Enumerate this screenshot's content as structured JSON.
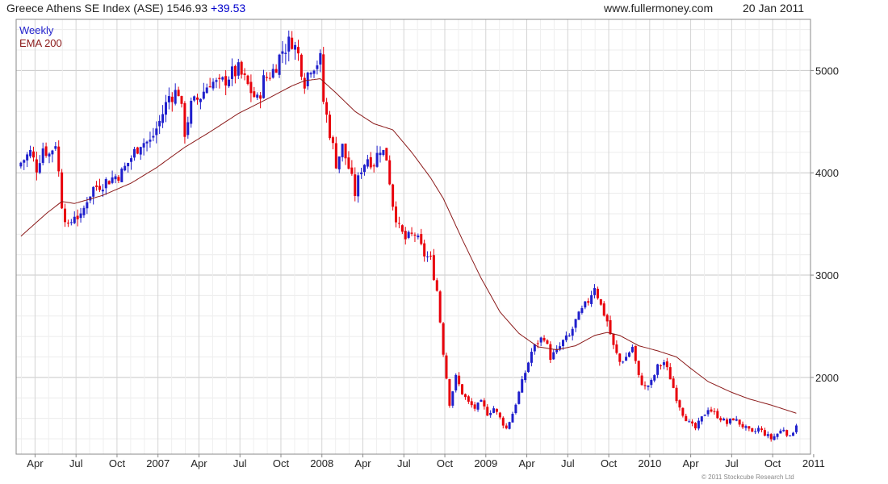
{
  "header": {
    "title": "Greece Athens SE Index (ASE) 1546.93",
    "change": "+39.53",
    "site": "www.fullermoney.com",
    "date": "20 Jan 2011"
  },
  "legend": {
    "period": "Weekly",
    "ema": "EMA 200"
  },
  "copyright": "© 2011 Stockcube Research Ltd",
  "colors": {
    "up": "#1f1fcc",
    "down": "#e8000b",
    "ema": "#8b1a1a",
    "grid": "#dddddd"
  },
  "chart_data": {
    "type": "candlestick",
    "title": "Greece Athens SE Index (ASE)",
    "xlabel": "",
    "ylabel": "",
    "ylim": [
      1250,
      5500
    ],
    "y_ticks": [
      2000,
      3000,
      4000,
      5000
    ],
    "x_ticks": [
      {
        "week": 4.5,
        "label": "Apr"
      },
      {
        "week": 17.5,
        "label": "Jul"
      },
      {
        "week": 30.5,
        "label": "Oct"
      },
      {
        "week": 43.5,
        "label": "2007"
      },
      {
        "week": 56.5,
        "label": "Apr"
      },
      {
        "week": 69.5,
        "label": "Jul"
      },
      {
        "week": 82.5,
        "label": "Oct"
      },
      {
        "week": 95.5,
        "label": "2008"
      },
      {
        "week": 108.5,
        "label": "Apr"
      },
      {
        "week": 121.5,
        "label": "Jul"
      },
      {
        "week": 134.5,
        "label": "Oct"
      },
      {
        "week": 147.5,
        "label": "2009"
      },
      {
        "week": 160.5,
        "label": "Apr"
      },
      {
        "week": 173.5,
        "label": "Jul"
      },
      {
        "week": 186.5,
        "label": "Oct"
      },
      {
        "week": 199.5,
        "label": "2010"
      },
      {
        "week": 212.5,
        "label": "Apr"
      },
      {
        "week": 225.5,
        "label": "Jul"
      },
      {
        "week": 238.5,
        "label": "Oct"
      },
      {
        "week": 251.5,
        "label": "2011"
      }
    ],
    "close_anchors": [
      [
        0,
        4100
      ],
      [
        3,
        4200
      ],
      [
        5,
        4050
      ],
      [
        7,
        4250
      ],
      [
        9,
        4180
      ],
      [
        11,
        4300
      ],
      [
        13,
        3700
      ],
      [
        15,
        3450
      ],
      [
        17,
        3600
      ],
      [
        19,
        3550
      ],
      [
        21,
        3750
      ],
      [
        23,
        3850
      ],
      [
        26,
        3900
      ],
      [
        29,
        3950
      ],
      [
        32,
        4000
      ],
      [
        35,
        4150
      ],
      [
        38,
        4300
      ],
      [
        41,
        4300
      ],
      [
        44,
        4500
      ],
      [
        47,
        4750
      ],
      [
        50,
        4800
      ],
      [
        52,
        4400
      ],
      [
        54,
        4650
      ],
      [
        57,
        4750
      ],
      [
        60,
        4900
      ],
      [
        63,
        4850
      ],
      [
        66,
        4950
      ],
      [
        69,
        5000
      ],
      [
        72,
        4850
      ],
      [
        75,
        4700
      ],
      [
        77,
        4900
      ],
      [
        80,
        5000
      ],
      [
        83,
        5200
      ],
      [
        86,
        5300
      ],
      [
        88,
        5150
      ],
      [
        90,
        4900
      ],
      [
        92,
        5050
      ],
      [
        95,
        5100
      ],
      [
        96,
        4700
      ],
      [
        98,
        4400
      ],
      [
        100,
        4100
      ],
      [
        102,
        4250
      ],
      [
        104,
        4050
      ],
      [
        106,
        3800
      ],
      [
        108,
        4050
      ],
      [
        110,
        4150
      ],
      [
        112,
        4100
      ],
      [
        114,
        4250
      ],
      [
        116,
        4150
      ],
      [
        118,
        3700
      ],
      [
        120,
        3450
      ],
      [
        122,
        3350
      ],
      [
        125,
        3400
      ],
      [
        128,
        3200
      ],
      [
        130,
        3150
      ],
      [
        132,
        2850
      ],
      [
        134,
        2250
      ],
      [
        136,
        1750
      ],
      [
        138,
        2000
      ],
      [
        140,
        1850
      ],
      [
        142,
        1750
      ],
      [
        144,
        1700
      ],
      [
        146,
        1750
      ],
      [
        148,
        1650
      ],
      [
        150,
        1700
      ],
      [
        152,
        1600
      ],
      [
        154,
        1500
      ],
      [
        156,
        1650
      ],
      [
        158,
        1850
      ],
      [
        160,
        2050
      ],
      [
        162,
        2250
      ],
      [
        164,
        2350
      ],
      [
        166,
        2400
      ],
      [
        168,
        2200
      ],
      [
        170,
        2250
      ],
      [
        172,
        2350
      ],
      [
        174,
        2400
      ],
      [
        176,
        2550
      ],
      [
        178,
        2650
      ],
      [
        180,
        2750
      ],
      [
        182,
        2900
      ],
      [
        184,
        2700
      ],
      [
        186,
        2550
      ],
      [
        188,
        2300
      ],
      [
        190,
        2150
      ],
      [
        192,
        2200
      ],
      [
        194,
        2300
      ],
      [
        196,
        2000
      ],
      [
        198,
        1900
      ],
      [
        200,
        1950
      ],
      [
        202,
        2100
      ],
      [
        204,
        2150
      ],
      [
        206,
        2000
      ],
      [
        208,
        1800
      ],
      [
        210,
        1650
      ],
      [
        212,
        1550
      ],
      [
        214,
        1500
      ],
      [
        216,
        1600
      ],
      [
        218,
        1700
      ],
      [
        220,
        1650
      ],
      [
        222,
        1600
      ],
      [
        224,
        1550
      ],
      [
        226,
        1600
      ],
      [
        228,
        1550
      ],
      [
        230,
        1500
      ],
      [
        232,
        1450
      ],
      [
        234,
        1500
      ],
      [
        236,
        1450
      ],
      [
        238,
        1400
      ],
      [
        240,
        1450
      ],
      [
        242,
        1500
      ],
      [
        244,
        1410
      ],
      [
        246,
        1547
      ]
    ],
    "ema_anchors": [
      [
        0,
        3380
      ],
      [
        8,
        3600
      ],
      [
        13,
        3720
      ],
      [
        17,
        3700
      ],
      [
        26,
        3780
      ],
      [
        35,
        3900
      ],
      [
        43,
        4050
      ],
      [
        52,
        4250
      ],
      [
        60,
        4400
      ],
      [
        69,
        4580
      ],
      [
        78,
        4720
      ],
      [
        86,
        4850
      ],
      [
        90,
        4900
      ],
      [
        95,
        4920
      ],
      [
        100,
        4780
      ],
      [
        106,
        4600
      ],
      [
        112,
        4480
      ],
      [
        118,
        4420
      ],
      [
        124,
        4200
      ],
      [
        130,
        3950
      ],
      [
        134,
        3750
      ],
      [
        140,
        3350
      ],
      [
        146,
        2970
      ],
      [
        152,
        2640
      ],
      [
        158,
        2430
      ],
      [
        164,
        2300
      ],
      [
        170,
        2270
      ],
      [
        176,
        2310
      ],
      [
        182,
        2410
      ],
      [
        186,
        2440
      ],
      [
        190,
        2410
      ],
      [
        196,
        2310
      ],
      [
        202,
        2260
      ],
      [
        208,
        2200
      ],
      [
        212,
        2100
      ],
      [
        218,
        1960
      ],
      [
        225,
        1860
      ],
      [
        231,
        1790
      ],
      [
        238,
        1730
      ],
      [
        244,
        1670
      ],
      [
        246,
        1650
      ]
    ]
  }
}
